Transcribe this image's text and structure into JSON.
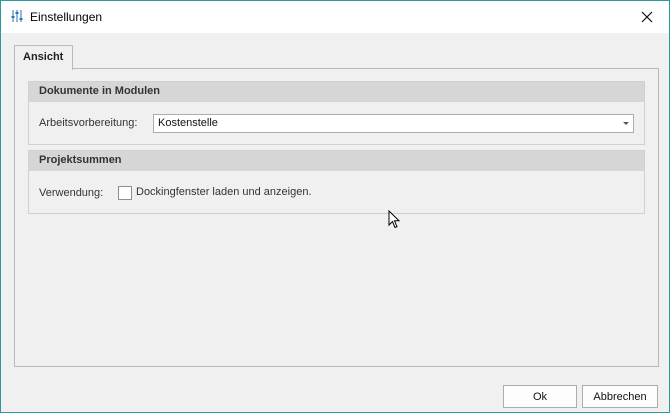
{
  "window": {
    "title": "Einstellungen",
    "accent_border": "#2a9a9c",
    "title_icon": "sliders-icon",
    "close_icon": "close-icon"
  },
  "tabs": [
    {
      "label": "Ansicht",
      "active": true
    }
  ],
  "groups": {
    "dokumente": {
      "title": "Dokumente in Modulen",
      "field_label": "Arbeitsvorbereitung:",
      "combo_value": "Kostenstelle"
    },
    "projektsummen": {
      "title": "Projektsummen",
      "field_label": "Verwendung:",
      "checkbox_label": "Dockingfenster laden und anzeigen.",
      "checkbox_checked": false
    }
  },
  "buttons": {
    "ok": "Ok",
    "cancel": "Abbrechen"
  }
}
